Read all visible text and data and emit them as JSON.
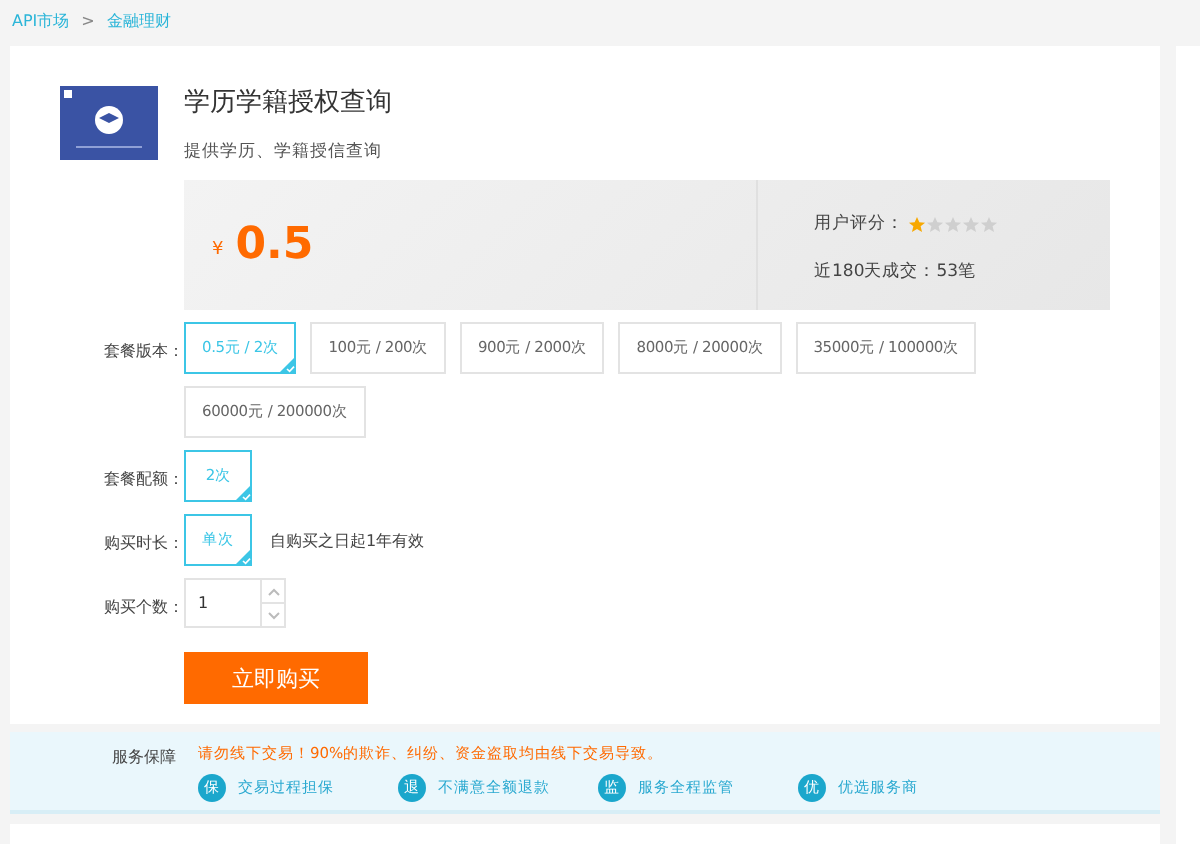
{
  "breadcrumb": [
    {
      "label": "API市场"
    },
    {
      "label": ">"
    },
    {
      "label": "金融理财"
    }
  ],
  "product": {
    "title": "学历学籍授权查询",
    "subtitle": "提供学历、学籍授信查询",
    "currency": "¥",
    "price": "0.5",
    "rating_label": "用户评分：",
    "stars": 1,
    "sales": "近180天成交：53笔"
  },
  "options": [
    {
      "label": "套餐版本：",
      "choices": [
        {
          "label": "0.5元 / 2次",
          "selected": true
        },
        {
          "label": "100元 / 200次",
          "selected": false
        },
        {
          "label": "900元 / 2000次",
          "selected": false
        },
        {
          "label": "8000元 / 20000次",
          "selected": false
        },
        {
          "label": "35000元 / 100000次",
          "selected": false
        },
        {
          "label": "60000元 / 200000次",
          "selected": false
        }
      ]
    },
    {
      "label": "套餐配额：",
      "choices": [
        {
          "label": "2次",
          "selected": true
        }
      ]
    },
    {
      "label": "购买时长：",
      "choices": [
        {
          "label": "单次",
          "selected": true
        }
      ],
      "note": "自购买之日起1年有效"
    }
  ],
  "quantity": {
    "label": "购买个数：",
    "value": "1"
  },
  "buy_button": "立即购买",
  "guarantee": {
    "label": "服务保障",
    "warning": "请勿线下交易！90%的欺诈、纠纷、资金盗取均由线下交易导致。",
    "items": [
      {
        "badge": "保",
        "label": "交易过程担保"
      },
      {
        "badge": "退",
        "label": "不满意全额退款"
      },
      {
        "badge": "监",
        "label": "服务全程监管"
      },
      {
        "badge": "优",
        "label": "优选服务商"
      }
    ]
  }
}
